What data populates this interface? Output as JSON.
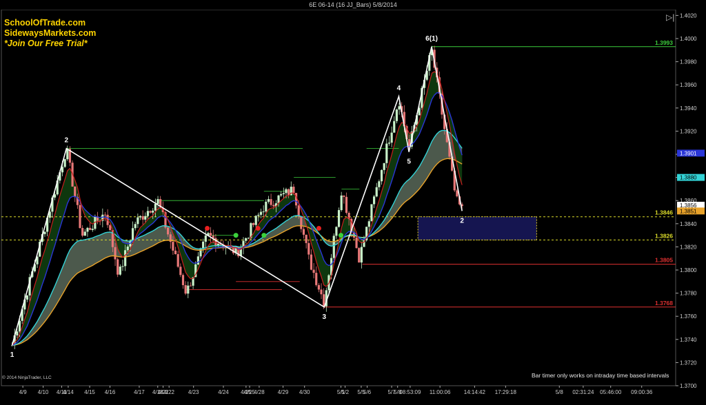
{
  "window": {
    "title": "6E 06-14 (16 JJ_Bars)  5/8/2014"
  },
  "branding": {
    "lines": [
      "SchoolOfTrade.com",
      "SidewaysMarkets.com",
      "*Join Our Free Trial*"
    ],
    "color": "#ffd400"
  },
  "footer": {
    "copyright": "© 2014 NinjaTrader, LLC",
    "timer_note": "Bar timer only works on intraday time based intervals"
  },
  "colors": {
    "bull": "#c8f0c8",
    "bear": "#e87878",
    "level_green": "#3ccf3c",
    "level_red": "#e03030",
    "dashed_yellow": "#dede2a",
    "ema_fast": "#c81e1e",
    "ema_mid": "#2a36d8",
    "ema_slow": "#33d3d6",
    "ema_slowest": "#e8a22a",
    "zone_fill": "#151550",
    "zone_border": "#e8d22a",
    "cloud_green": "#0f3a0f",
    "cloud_gray": "#8aa28a"
  },
  "chart_data": {
    "type": "candlestick",
    "instrument": "6E 06-14",
    "ylim": [
      1.37,
      1.4025
    ],
    "y_ticks": [
      "1.3700",
      "1.3720",
      "1.3740",
      "1.3760",
      "1.3780",
      "1.3800",
      "1.3820",
      "1.3840",
      "1.3860",
      "1.3880",
      "1.3900",
      "1.3920",
      "1.3940",
      "1.3960",
      "1.3980",
      "1.4000",
      "1.4020"
    ],
    "x_ticks": [
      "4/9",
      "4/10",
      "4/11",
      "4/14",
      "4/15",
      "4/16",
      "4/17",
      "4/18",
      "4/21",
      "4/22",
      "4/23",
      "4/24",
      "4/25",
      "4/25",
      "4/28",
      "4/29",
      "4/30",
      "5/1",
      "5/2",
      "5/5",
      "5/6",
      "5/7",
      "5/8",
      "08:53:09",
      "11:00:06",
      "14:14:42",
      "17:29:18",
      "5/8",
      "02:31:24",
      "05:46:00",
      "09:00:36"
    ],
    "x_tick_positions": [
      0.036,
      0.07,
      0.101,
      0.112,
      0.148,
      0.182,
      0.231,
      0.262,
      0.271,
      0.281,
      0.322,
      0.372,
      0.41,
      0.416,
      0.432,
      0.472,
      0.508,
      0.569,
      0.576,
      0.603,
      0.613,
      0.654,
      0.664,
      0.685,
      0.735,
      0.793,
      0.845,
      0.935,
      0.975,
      1.021,
      1.073
    ],
    "price_range": [
      1.3735,
      1.3993
    ],
    "wave_labels": [
      {
        "label": "1",
        "x": 0.018,
        "price": 1.3735,
        "pos": "below"
      },
      {
        "label": "2",
        "x": 0.109,
        "price": 1.3905,
        "pos": "above"
      },
      {
        "label": "3",
        "x": 0.541,
        "price": 1.3768,
        "pos": "below"
      },
      {
        "label": "4",
        "x": 0.666,
        "price": 1.395,
        "pos": "above"
      },
      {
        "label": "5",
        "x": 0.683,
        "price": 1.3902,
        "pos": "below"
      },
      {
        "label": "6(1)",
        "x": 0.721,
        "price": 1.3993,
        "pos": "above"
      },
      {
        "label": "2",
        "x": 0.772,
        "price": 1.3851,
        "pos": "below"
      }
    ],
    "levels": [
      {
        "price": 1.3993,
        "label": "1.3993",
        "color": "green",
        "from": 0.721
      },
      {
        "price": 1.3846,
        "label": "1.3846",
        "color": "yellow-dashed",
        "from": 0.0
      },
      {
        "price": 1.3826,
        "label": "1.3826",
        "color": "yellow-dashed",
        "from": 0.0
      },
      {
        "price": 1.3805,
        "label": "1.3805",
        "color": "red",
        "from": 0.605
      },
      {
        "price": 1.3768,
        "label": "1.3768",
        "color": "red",
        "from": 0.541
      }
    ],
    "price_tags": [
      {
        "price": 1.3901,
        "label": "1.3901",
        "color": "#2a36d8"
      },
      {
        "price": 1.388,
        "label": "1.3880",
        "color": "#33d3d6"
      },
      {
        "price": 1.3856,
        "label": "1.3856",
        "color": "#ffffff"
      },
      {
        "price": 1.3851,
        "label": "1.3851",
        "color": "#e8a22a"
      }
    ],
    "zone": {
      "from": 0.698,
      "to": 0.897,
      "top": 1.3846,
      "bottom": 1.3826
    },
    "green_dots_x": [
      0.393,
      0.44,
      0.569
    ],
    "red_dots_x": [
      0.345,
      0.43,
      0.532
    ],
    "close": 1.3856
  }
}
